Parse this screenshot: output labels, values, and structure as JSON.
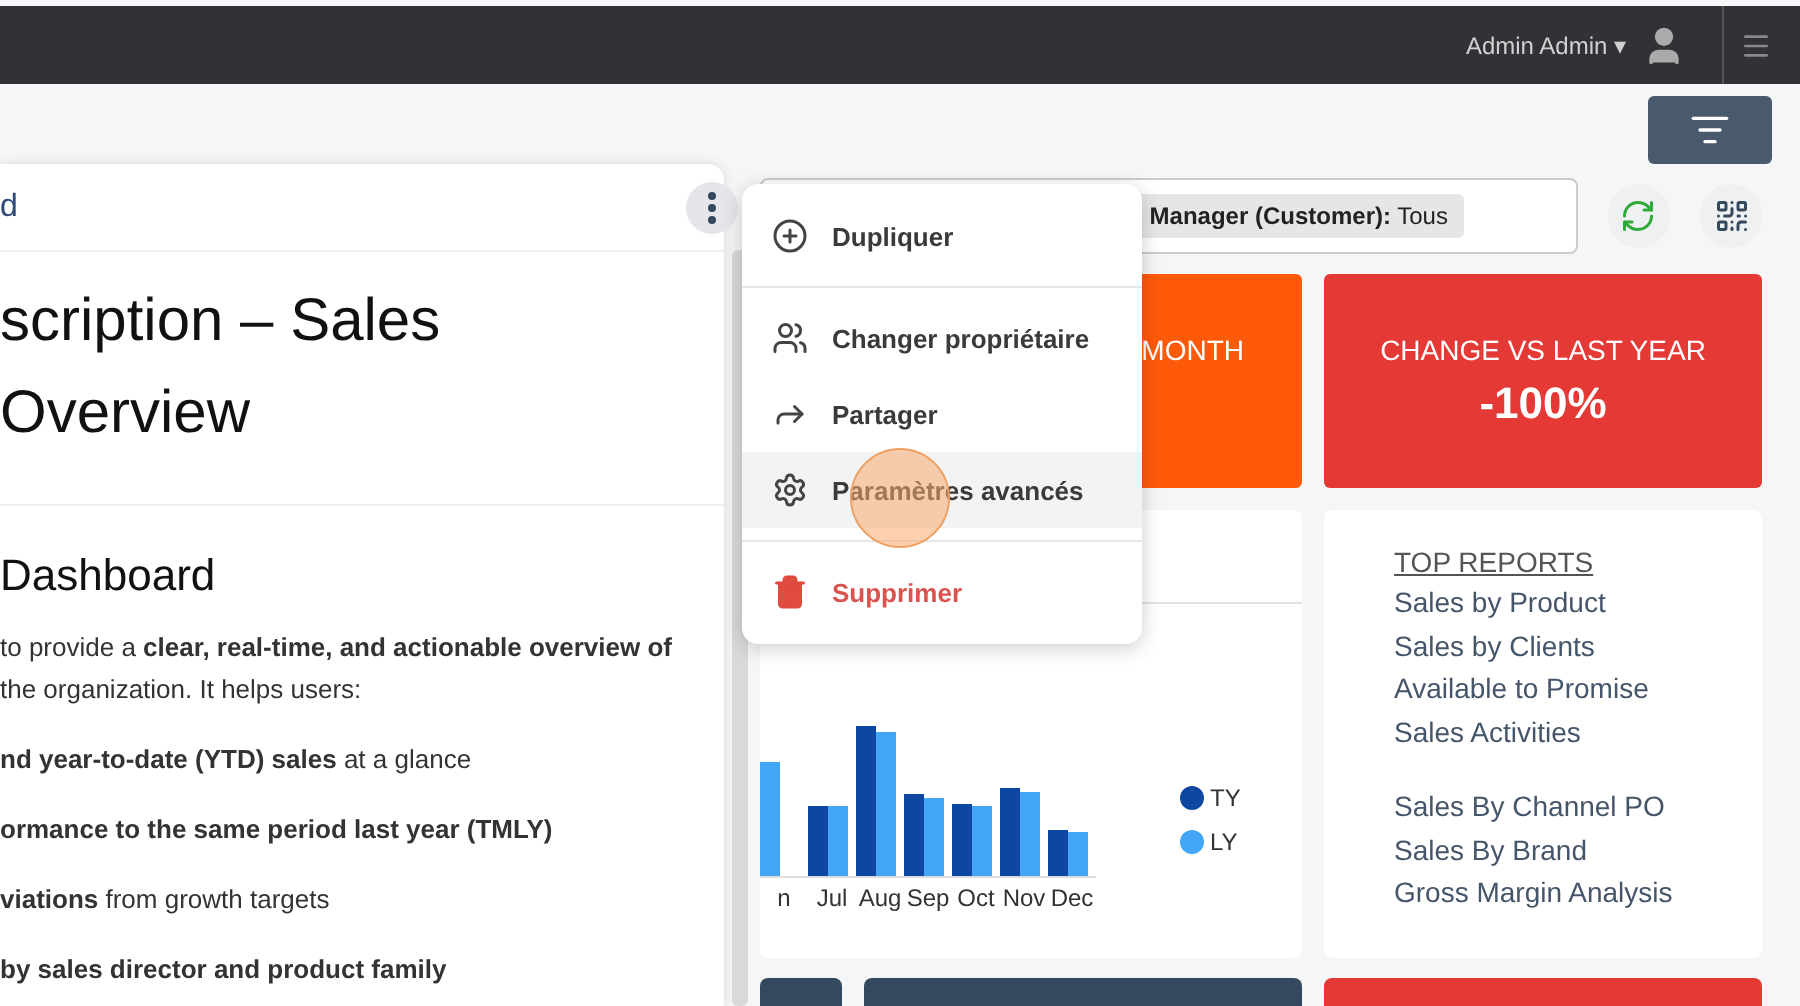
{
  "topbar": {
    "user": "Admin Admin ▾"
  },
  "filter": {
    "chip": "**Manager (Customer):** Tous"
  },
  "kpis": [
    {
      "title": "MONTH",
      "color": "#ff5a0a"
    },
    {
      "title": "CHANGE VS LAST YEAR",
      "value": "-100%",
      "color": "#e53935"
    }
  ],
  "chart": {
    "months": [
      "n",
      "Jul",
      "Aug",
      "Sep",
      "Oct",
      "Nov",
      "Dec"
    ],
    "legend": [
      {
        "name": "TY",
        "color": "#0d47a1"
      },
      {
        "name": "LY",
        "color": "#42a5f5"
      }
    ]
  },
  "reports": {
    "title": "TOP REPORTS",
    "groups": [
      [
        "Sales by Product",
        "Sales by Clients",
        "Available to Promise",
        "Sales Activities"
      ],
      [
        "Sales By Channel PO",
        "Sales By Brand",
        "Gross Margin Analysis"
      ]
    ]
  },
  "bottom_cards": [
    {
      "color": "#34495e"
    },
    {
      "color": "#34495e"
    },
    {
      "color": "#e53935"
    }
  ],
  "panel": {
    "header": "d",
    "title_lines": [
      "scription – Sales",
      "Overview"
    ],
    "heading": "Dashboard",
    "paragraph_lines": [
      "to provide a **clear, real-time, and actionable overview of**",
      "the organization. It helps users:"
    ],
    "bullets": [
      "**nd year-to-date (YTD) sales** at a glance",
      "**ormance to the same period last year (TMLY)**",
      "**viations** from growth targets",
      "**by sales director and product family**"
    ]
  },
  "menu": [
    {
      "kind": "item",
      "label": "Dupliquer",
      "selected": false
    },
    {
      "kind": "divider"
    },
    {
      "kind": "item",
      "label": "Changer propriétaire",
      "selected": false
    },
    {
      "kind": "item",
      "label": "Partager",
      "selected": false
    },
    {
      "kind": "item",
      "label": "Paramètres avancés",
      "selected": true
    },
    {
      "kind": "divider"
    },
    {
      "kind": "danger",
      "label": "Supprimer",
      "selected": false
    }
  ]
}
